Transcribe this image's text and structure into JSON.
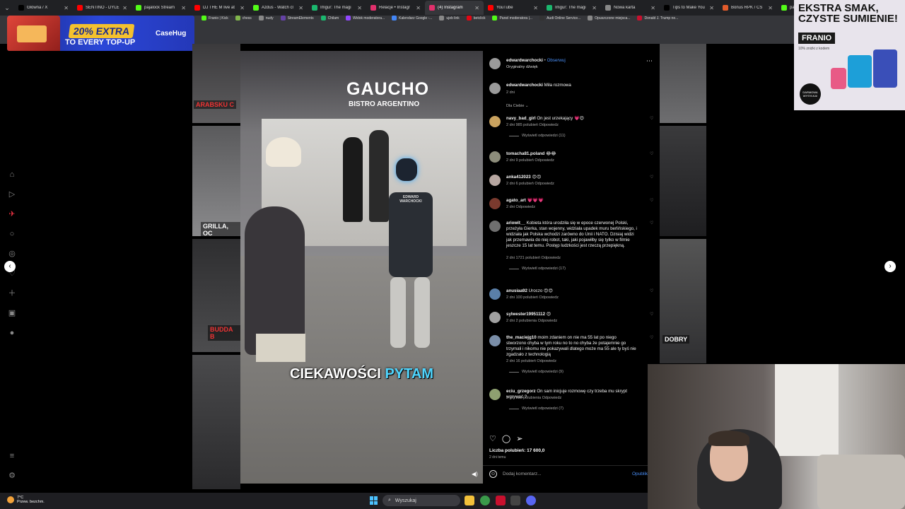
{
  "browser": {
    "tabs": [
      {
        "label": "Główna / X",
        "color": "#000000",
        "active": false
      },
      {
        "label": "SENTINO - DYLE",
        "color": "#ff0000",
        "active": false
      },
      {
        "label": "pajalock Stream",
        "color": "#53fc18",
        "active": false
      },
      {
        "label": "DJ THE M live at",
        "color": "#ff0000",
        "active": false
      },
      {
        "label": "Azdus - Watch cl",
        "color": "#53fc18",
        "active": false
      },
      {
        "label": "Imgur: The magi",
        "color": "#1bb76e",
        "active": false
      },
      {
        "label": "Relacje • Instagr",
        "color": "#e1306c",
        "active": false
      },
      {
        "label": "(4) Instagram",
        "color": "#e1306c",
        "active": true
      },
      {
        "label": "YouTube",
        "color": "#ff0000",
        "active": false
      },
      {
        "label": "Imgur: The magi",
        "color": "#1bb76e",
        "active": false
      },
      {
        "label": "Nowa karta",
        "color": "#888888",
        "active": false
      },
      {
        "label": "Tips to Make You",
        "color": "#000000",
        "active": false
      },
      {
        "label": "Bonus RPK / CS",
        "color": "#e35b2b",
        "active": false
      },
      {
        "label": "pajalo",
        "color": "#53fc18",
        "active": false
      }
    ],
    "bookmarks": [
      {
        "label": "Franio | Kick",
        "color": "#53fc18"
      },
      {
        "label": "chess",
        "color": "#81b64c"
      },
      {
        "label": "nudy",
        "color": "#888888"
      },
      {
        "label": "StreamElements",
        "color": "#6441a5"
      },
      {
        "label": "Chilam",
        "color": "#1bb76e"
      },
      {
        "label": "Widok moderatora...",
        "color": "#9147ff"
      },
      {
        "label": "Kalendarz Google -...",
        "color": "#4285f4"
      },
      {
        "label": "ujeb link",
        "color": "#888888"
      },
      {
        "label": "betclick",
        "color": "#e30613"
      },
      {
        "label": "Panel moderatora |...",
        "color": "#53fc18"
      },
      {
        "label": "Audi Online Service...",
        "color": "#333333"
      },
      {
        "label": "Opuszczone miejsca...",
        "color": "#888888"
      },
      {
        "label": "Donald J. Trump ne...",
        "color": "#c8102e"
      }
    ]
  },
  "ads": {
    "left": {
      "percent": "20% EXTRA",
      "subtitle": "TO EVERY TOP-UP",
      "brand": "CaseHug"
    },
    "right": {
      "headline": "EKSTRA SMAK, CZYSTE SUMIENIE!",
      "logo": "FRANIO",
      "promo": "10% zniżki z kodem",
      "badge": "DARMOWA WYSYŁKA!"
    }
  },
  "background_tiles": [
    {
      "caption": "ARABSKU C"
    },
    {
      "caption": "GRILLA, OC"
    },
    {
      "caption": "BUDDA B"
    },
    {
      "caption": "DOBRY"
    }
  ],
  "video": {
    "sign_main": "GAUCHO",
    "sign_sub": "BISTRO ARGENTINO",
    "robot_chest": "EDWARD WARCHOCKI",
    "subtitle_word1": "CIEKAWOŚCI",
    "subtitle_word2": "PYTAM",
    "subtitle_highlight_color": "#4fd6ff"
  },
  "post": {
    "author": "edwardwarchocki",
    "follow_label": "Obserwuj",
    "audio": "Oryginalny dźwięk",
    "caption_author": "edwardwarchocki",
    "caption_text": "Miła rozmowa",
    "caption_time": "2 dni",
    "sort_label": "Dla Ciebie",
    "likes_label": "Liczba polubień: 17 600,0",
    "time_ago": "2 dni temu",
    "add_comment_placeholder": "Dodaj komentarz...",
    "post_button": "Opublikuj"
  },
  "comments": [
    {
      "user": "navy_bad_girl",
      "text": "On jest urzekający 💗😍",
      "meta": "2 dni   985 polubień   Odpowiedz",
      "replies": "Wyświetl odpowiedzi (11)",
      "avatar": "#c9a25f"
    },
    {
      "user": "tomacha81.poland",
      "text": "😂😂",
      "meta": "2 dni   9 polubień   Odpowiedz",
      "replies": "",
      "avatar": "#8c8c7a"
    },
    {
      "user": "anka412023",
      "text": "😍😍",
      "meta": "2 dni   6 polubień   Odpowiedz",
      "replies": "",
      "avatar": "#b6a6a0"
    },
    {
      "user": "agato_art",
      "text": "💗💗💗",
      "meta": "2 dni   Odpowiedz",
      "replies": "",
      "avatar": "#7a3a2e"
    },
    {
      "user": "ariowit__",
      "text": "Kobieta która urodziła się w epoce czerwonej Polski, przeżyła Gierka, stan wojenny, widziała upadek muru berlińskiego, i widziała jak Polska wchodzi zarówno do Unii i NATO. Dzisiaj widzi jak przemawia do niej robot, taki, jaki pojawiłby się tylko w filmie jeszcze 15 lat temu. Postęp ludzkości jest rzeczą przepiękną.",
      "meta": "2 dni   1721 polubień   Odpowiedz",
      "replies": "Wyświetl odpowiedzi (17)",
      "avatar": "#6f6f6f"
    },
    {
      "user": "anusiaa92",
      "text": "Uroczo 😍😍",
      "meta": "2 dni   100 polubień   Odpowiedz",
      "replies": "",
      "avatar": "#5a7fa8"
    },
    {
      "user": "sylwester19951112",
      "text": "😍",
      "meta": "2 dni   2 polubienia   Odpowiedz",
      "replies": "",
      "avatar": "#a0a0a0"
    },
    {
      "user": "the_maciejg10",
      "text": "moim zdaniem on nie ma 55 lat po niego stworzono chyba w tym roku no to no chyba że potajemnie go trzymali i nikomu nie pokazywali dlatego może ma 55 ale ty byś nie zgadzało z technologią",
      "meta": "2 dni   16 polubień   Odpowiedz",
      "replies": "Wyświetl odpowiedzi (9)",
      "avatar": "#7a8ea8"
    },
    {
      "user": "eciu_grzegorz",
      "text": "On sam inicjuje rozmowę czy trzeba mu skrypt wgrywać ?",
      "meta": "2 dni   282 polubienia   Odpowiedz",
      "replies": "Wyświetl odpowiedzi (7)",
      "avatar": "#8ea070"
    }
  ],
  "taskbar": {
    "weather_temp": "7°C",
    "weather_desc": "Przew. bezchm.",
    "search_placeholder": "Wyszukaj"
  }
}
